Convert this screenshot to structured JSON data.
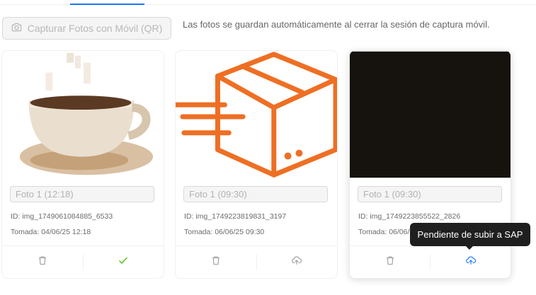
{
  "toolbar": {
    "capture_button_label": "Capturar Fotos con Móvil (QR)",
    "capture_button_icon": "camera-icon",
    "hint_text": "Las fotos se guardan automáticamente al cerrar la sesión de captura móvil."
  },
  "photos": [
    {
      "image": "coffee-cup-image",
      "name_value": "Foto 1 (12:18)",
      "id_text": "ID: img_1749061084885_6533",
      "taken_text": "Tomada: 04/06/25 12:18",
      "delete_icon": "trash-icon",
      "status_icon": "check-icon",
      "status": "synced"
    },
    {
      "image": "delivery-box-image",
      "name_value": "Foto 1 (09:30)",
      "id_text": "ID: img_1749223819831_3197",
      "taken_text": "Tomada: 06/06/25 09:30",
      "delete_icon": "trash-icon",
      "status_icon": "cloud-upload-icon",
      "status": "pending"
    },
    {
      "image": "dark-image",
      "name_value": "Foto 1 (09:30)",
      "id_text": "ID: img_1749223855522_2826",
      "taken_text": "Tomada: 06/06/25 09:30",
      "delete_icon": "trash-icon",
      "status_icon": "cloud-upload-icon",
      "status": "pending"
    }
  ],
  "tooltip": {
    "text": "Pendiente de subir a SAP"
  },
  "colors": {
    "accent": "#1677ff",
    "success": "#52c41a",
    "box_orange": "#ee6f24",
    "icon_grey": "#9a9a9a"
  }
}
